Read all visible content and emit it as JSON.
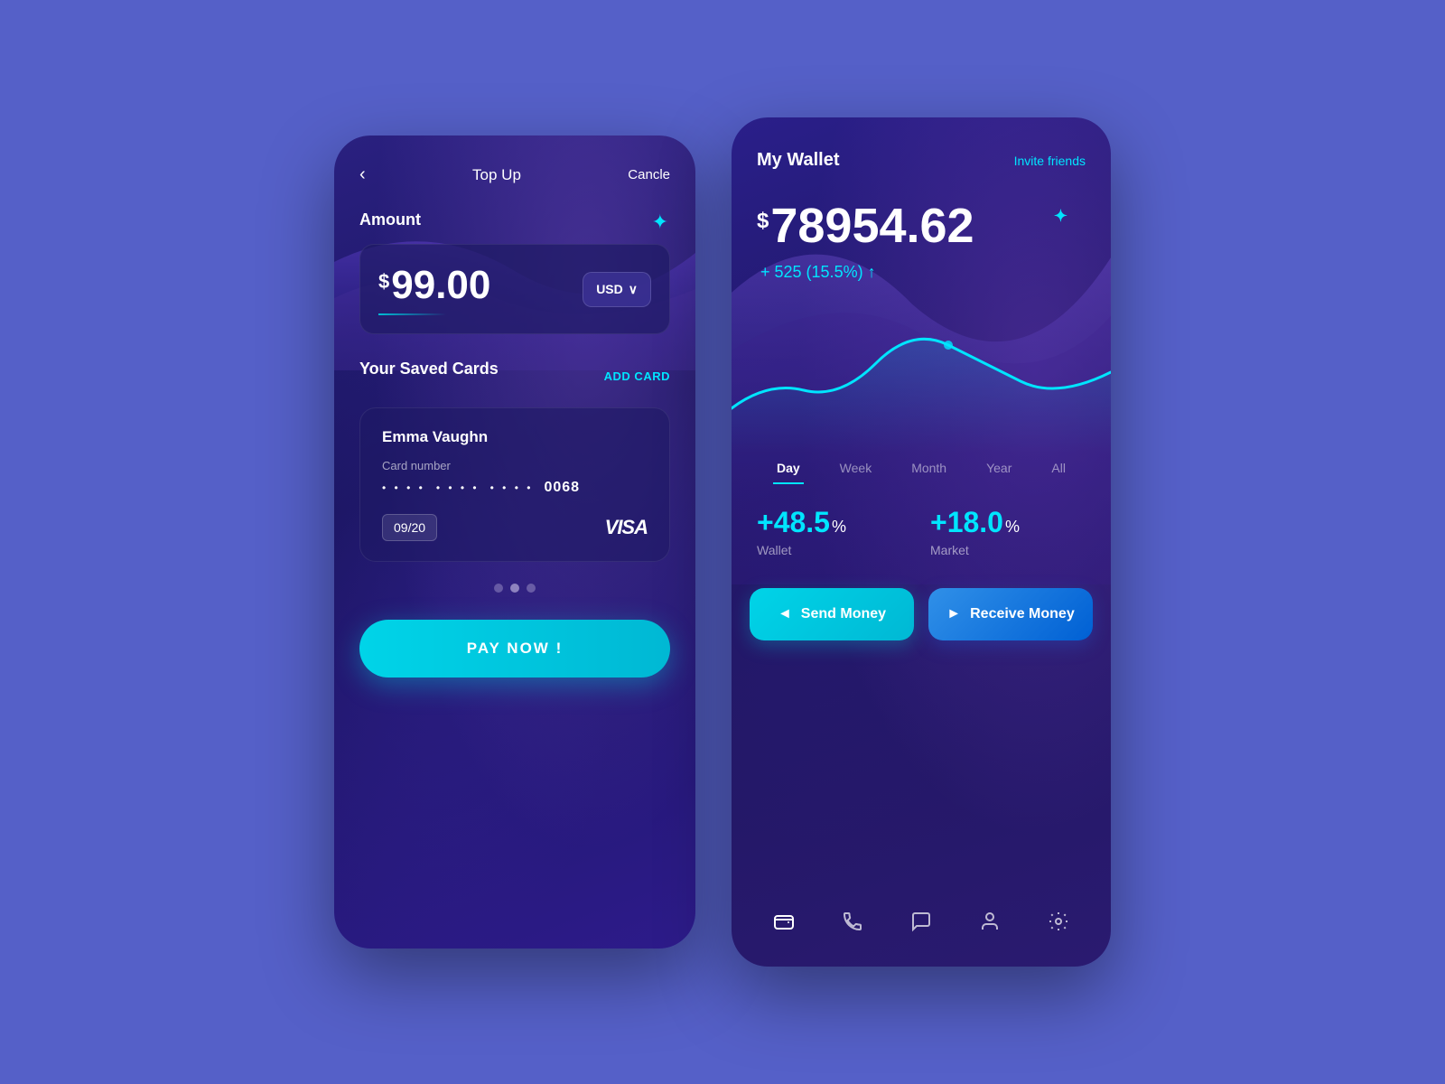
{
  "left_phone": {
    "header": {
      "back_label": "‹",
      "title": "Top Up",
      "cancel_label": "Cancle"
    },
    "amount_section": {
      "label": "Amount",
      "value": "99.00",
      "currency_symbol": "$",
      "currency": "USD",
      "star": "✦"
    },
    "saved_cards": {
      "label": "Your Saved Cards",
      "add_card_label": "ADD CARD",
      "card": {
        "holder": "Emma Vaughn",
        "number_label": "Card number",
        "dots1": "• • • •",
        "dots2": "• • • •",
        "dots3": "• • • •",
        "last4": "0068",
        "expiry": "09/20",
        "brand": "VISA"
      }
    },
    "pay_button": {
      "label": "PAY NOW !"
    },
    "dots": [
      "inactive",
      "active",
      "inactive"
    ]
  },
  "right_phone": {
    "header": {
      "title": "My Wallet",
      "invite_label": "Invite friends"
    },
    "balance": {
      "currency_symbol": "$",
      "amount": "78954.62",
      "change": "+ 525 (15.5%) ↑",
      "star": "✦"
    },
    "chart_tabs": [
      {
        "label": "Day",
        "active": true
      },
      {
        "label": "Week",
        "active": false
      },
      {
        "label": "Month",
        "active": false
      },
      {
        "label": "Year",
        "active": false
      },
      {
        "label": "All",
        "active": false
      }
    ],
    "stats": [
      {
        "value": "+48.5",
        "percent": "%",
        "label": "Wallet"
      },
      {
        "value": "+18.0",
        "percent": "%",
        "label": "Market"
      }
    ],
    "actions": [
      {
        "label": "Send Money",
        "icon": "◄"
      },
      {
        "label": "Receive Money",
        "icon": "►"
      }
    ],
    "nav_icons": [
      {
        "name": "wallet-icon",
        "symbol": "▣"
      },
      {
        "name": "phone-icon",
        "symbol": "📞"
      },
      {
        "name": "chat-icon",
        "symbol": "💬"
      },
      {
        "name": "user-icon",
        "symbol": "👤"
      },
      {
        "name": "settings-icon",
        "symbol": "⚙"
      }
    ]
  }
}
